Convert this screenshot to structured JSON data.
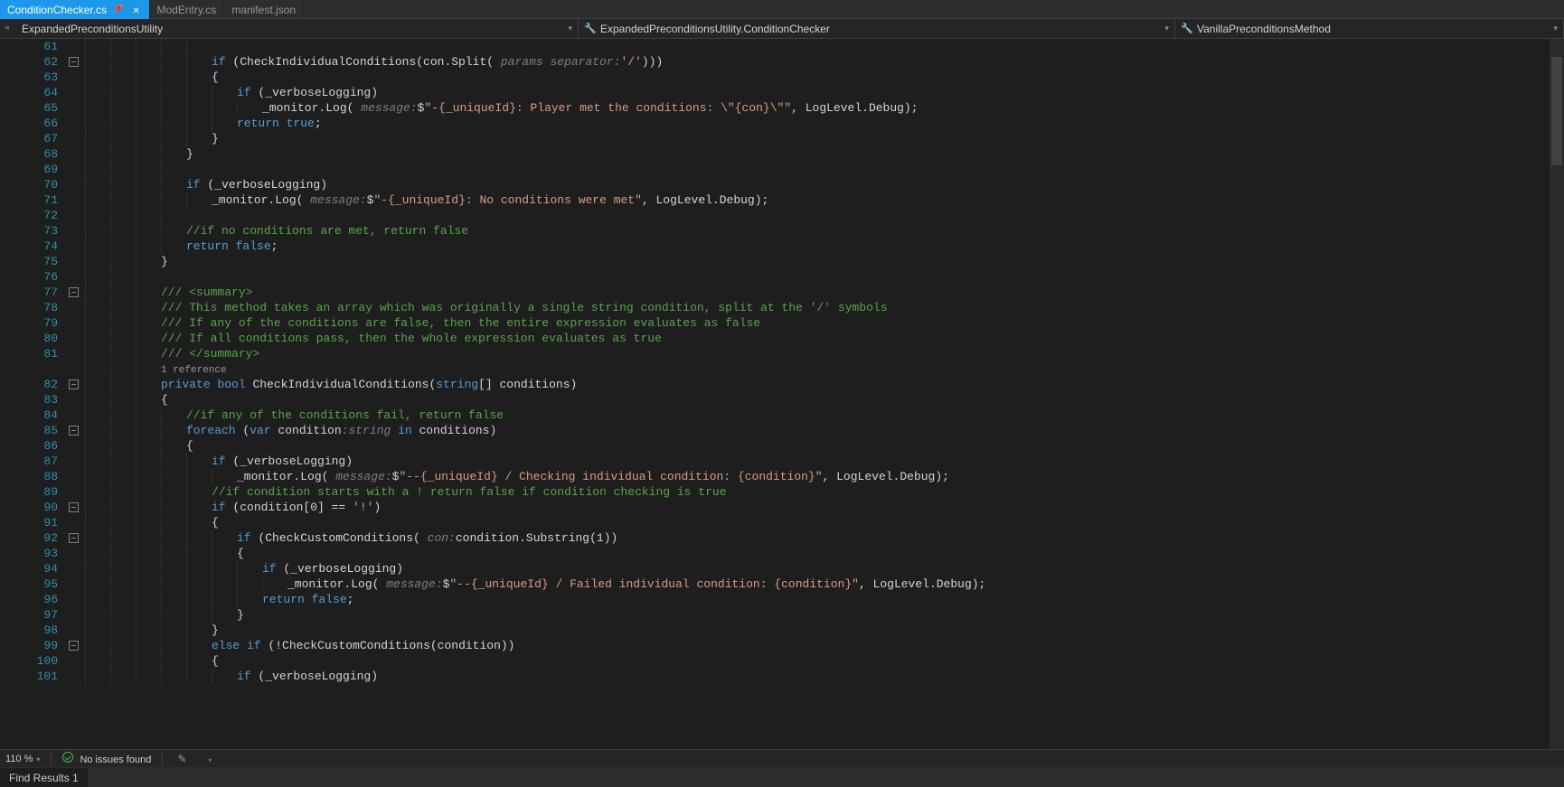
{
  "tabs": [
    {
      "label": "ConditionChecker.cs",
      "active": true,
      "pinned": true
    },
    {
      "label": "ModEntry.cs",
      "active": false
    },
    {
      "label": "manifest.json",
      "active": false
    }
  ],
  "breadcrumb": {
    "namespace": "ExpandedPreconditionsUtility",
    "class": "ExpandedPreconditionsUtility.ConditionChecker",
    "method": "VanillaPreconditionsMethod"
  },
  "codelines": [
    {
      "n": 61,
      "fold": false,
      "indent": 5,
      "tokens": []
    },
    {
      "n": 62,
      "fold": true,
      "indent": 5,
      "tokens": [
        [
          "kw",
          "if"
        ],
        [
          "id",
          " (CheckIndividualConditions(con.Split( "
        ],
        [
          "param-hint",
          "params separator:"
        ],
        [
          "str",
          "'/'"
        ],
        [
          "id",
          ")))"
        ]
      ]
    },
    {
      "n": 63,
      "fold": false,
      "indent": 5,
      "tokens": [
        [
          "id",
          "{"
        ]
      ]
    },
    {
      "n": 64,
      "fold": false,
      "indent": 6,
      "tokens": [
        [
          "kw",
          "if"
        ],
        [
          "id",
          " (_verboseLogging)"
        ]
      ]
    },
    {
      "n": 65,
      "fold": false,
      "indent": 7,
      "tokens": [
        [
          "id",
          "_monitor.Log( "
        ],
        [
          "param-hint",
          "message:"
        ],
        [
          "id",
          "$"
        ],
        [
          "str",
          "\"-{_uniqueId}: Player met the conditions: \\\"{con}\\\"\""
        ],
        [
          "id",
          ", LogLevel.Debug);"
        ]
      ]
    },
    {
      "n": 66,
      "fold": false,
      "indent": 6,
      "tokens": [
        [
          "kw",
          "return"
        ],
        [
          "id",
          " "
        ],
        [
          "kw",
          "true"
        ],
        [
          "id",
          ";"
        ]
      ]
    },
    {
      "n": 67,
      "fold": false,
      "indent": 5,
      "tokens": [
        [
          "id",
          "}"
        ]
      ]
    },
    {
      "n": 68,
      "fold": false,
      "indent": 4,
      "tokens": [
        [
          "id",
          "}"
        ]
      ]
    },
    {
      "n": 69,
      "fold": false,
      "indent": 4,
      "tokens": []
    },
    {
      "n": 70,
      "fold": false,
      "indent": 4,
      "tokens": [
        [
          "kw",
          "if"
        ],
        [
          "id",
          " (_verboseLogging)"
        ]
      ]
    },
    {
      "n": 71,
      "fold": false,
      "indent": 5,
      "tokens": [
        [
          "id",
          "_monitor.Log( "
        ],
        [
          "param-hint",
          "message:"
        ],
        [
          "id",
          "$"
        ],
        [
          "str",
          "\"-{_uniqueId}: No conditions were met\""
        ],
        [
          "id",
          ", LogLevel.Debug);"
        ]
      ]
    },
    {
      "n": 72,
      "fold": false,
      "indent": 4,
      "tokens": []
    },
    {
      "n": 73,
      "fold": false,
      "indent": 4,
      "tokens": [
        [
          "cmt",
          "//if no conditions are met, return false"
        ]
      ]
    },
    {
      "n": 74,
      "fold": false,
      "indent": 4,
      "tokens": [
        [
          "kw",
          "return"
        ],
        [
          "id",
          " "
        ],
        [
          "kw",
          "false"
        ],
        [
          "id",
          ";"
        ]
      ]
    },
    {
      "n": 75,
      "fold": false,
      "indent": 3,
      "tokens": [
        [
          "id",
          "}"
        ]
      ]
    },
    {
      "n": 76,
      "fold": false,
      "indent": 3,
      "tokens": []
    },
    {
      "n": 77,
      "fold": true,
      "indent": 3,
      "tokens": [
        [
          "cmt",
          "/// <summary>"
        ]
      ]
    },
    {
      "n": 78,
      "fold": false,
      "indent": 3,
      "tokens": [
        [
          "cmt",
          "/// This method takes an array which was originally a single string condition, split at the '/' symbols"
        ]
      ]
    },
    {
      "n": 79,
      "fold": false,
      "indent": 3,
      "tokens": [
        [
          "cmt",
          "/// If any of the conditions are false, then the entire expression evaluates as false"
        ]
      ]
    },
    {
      "n": 80,
      "fold": false,
      "indent": 3,
      "tokens": [
        [
          "cmt",
          "/// If all conditions pass, then the whole expression evaluates as true"
        ]
      ]
    },
    {
      "n": 81,
      "fold": false,
      "indent": 3,
      "tokens": [
        [
          "cmt",
          "/// </summary>"
        ]
      ]
    },
    {
      "n": -1,
      "fold": false,
      "indent": 3,
      "islens": true,
      "tokens": [
        [
          "ref-lens",
          "1 reference"
        ]
      ]
    },
    {
      "n": 82,
      "fold": true,
      "indent": 3,
      "tokens": [
        [
          "kw",
          "private"
        ],
        [
          "id",
          " "
        ],
        [
          "kw",
          "bool"
        ],
        [
          "id",
          " CheckIndividualConditions("
        ],
        [
          "kw",
          "string"
        ],
        [
          "id",
          "[] conditions)"
        ]
      ]
    },
    {
      "n": 83,
      "fold": false,
      "indent": 3,
      "tokens": [
        [
          "id",
          "{"
        ]
      ]
    },
    {
      "n": 84,
      "fold": false,
      "indent": 4,
      "tokens": [
        [
          "cmt",
          "//if any of the conditions fail, return false"
        ]
      ]
    },
    {
      "n": 85,
      "fold": true,
      "indent": 4,
      "tokens": [
        [
          "kw",
          "foreach"
        ],
        [
          "id",
          " ("
        ],
        [
          "kw",
          "var"
        ],
        [
          "id",
          " condition"
        ],
        [
          "param-hint",
          ":string"
        ],
        [
          "id",
          " "
        ],
        [
          "kw",
          "in"
        ],
        [
          "id",
          " conditions)"
        ]
      ]
    },
    {
      "n": 86,
      "fold": false,
      "indent": 4,
      "tokens": [
        [
          "id",
          "{"
        ]
      ]
    },
    {
      "n": 87,
      "fold": false,
      "indent": 5,
      "tokens": [
        [
          "kw",
          "if"
        ],
        [
          "id",
          " (_verboseLogging)"
        ]
      ]
    },
    {
      "n": 88,
      "fold": false,
      "indent": 6,
      "tokens": [
        [
          "id",
          "_monitor.Log( "
        ],
        [
          "param-hint",
          "message:"
        ],
        [
          "id",
          "$"
        ],
        [
          "str",
          "\"--{_uniqueId} / Checking individual condition: {condition}\""
        ],
        [
          "id",
          ", LogLevel.Debug);"
        ]
      ]
    },
    {
      "n": 89,
      "fold": false,
      "indent": 5,
      "tokens": [
        [
          "cmt",
          "//if condition starts with a ! return false if condition checking is true"
        ]
      ]
    },
    {
      "n": 90,
      "fold": true,
      "indent": 5,
      "tokens": [
        [
          "kw",
          "if"
        ],
        [
          "id",
          " (condition[0] == "
        ],
        [
          "str",
          "'!'"
        ],
        [
          "id",
          ")"
        ]
      ]
    },
    {
      "n": 91,
      "fold": false,
      "indent": 5,
      "tokens": [
        [
          "id",
          "{"
        ]
      ]
    },
    {
      "n": 92,
      "fold": true,
      "indent": 6,
      "tokens": [
        [
          "kw",
          "if"
        ],
        [
          "id",
          " (CheckCustomConditions( "
        ],
        [
          "param-hint",
          "con:"
        ],
        [
          "id",
          "condition.Substring(1))"
        ]
      ]
    },
    {
      "n": 93,
      "fold": false,
      "indent": 6,
      "tokens": [
        [
          "id",
          "{"
        ]
      ]
    },
    {
      "n": 94,
      "fold": false,
      "indent": 7,
      "tokens": [
        [
          "kw",
          "if"
        ],
        [
          "id",
          " (_verboseLogging)"
        ]
      ]
    },
    {
      "n": 95,
      "fold": false,
      "indent": 8,
      "tokens": [
        [
          "id",
          "_monitor.Log( "
        ],
        [
          "param-hint",
          "message:"
        ],
        [
          "id",
          "$"
        ],
        [
          "str",
          "\"--{_uniqueId} / Failed individual condition: {condition}\""
        ],
        [
          "id",
          ", LogLevel.Debug);"
        ]
      ]
    },
    {
      "n": 96,
      "fold": false,
      "indent": 7,
      "tokens": [
        [
          "kw",
          "return"
        ],
        [
          "id",
          " "
        ],
        [
          "kw",
          "false"
        ],
        [
          "id",
          ";"
        ]
      ]
    },
    {
      "n": 97,
      "fold": false,
      "indent": 6,
      "tokens": [
        [
          "id",
          "}"
        ]
      ]
    },
    {
      "n": 98,
      "fold": false,
      "indent": 5,
      "tokens": [
        [
          "id",
          "}"
        ]
      ]
    },
    {
      "n": 99,
      "fold": true,
      "indent": 5,
      "tokens": [
        [
          "kw",
          "else"
        ],
        [
          "id",
          " "
        ],
        [
          "kw",
          "if"
        ],
        [
          "id",
          " (!CheckCustomConditions(condition))"
        ]
      ]
    },
    {
      "n": 100,
      "fold": false,
      "indent": 5,
      "tokens": [
        [
          "id",
          "{"
        ]
      ]
    },
    {
      "n": 101,
      "fold": false,
      "indent": 6,
      "tokens": [
        [
          "kw",
          "if"
        ],
        [
          "id",
          " (_verboseLogging)"
        ]
      ]
    }
  ],
  "status": {
    "zoom": "110 %",
    "issues": "No issues found"
  },
  "bottom_tab": "Find Results 1"
}
